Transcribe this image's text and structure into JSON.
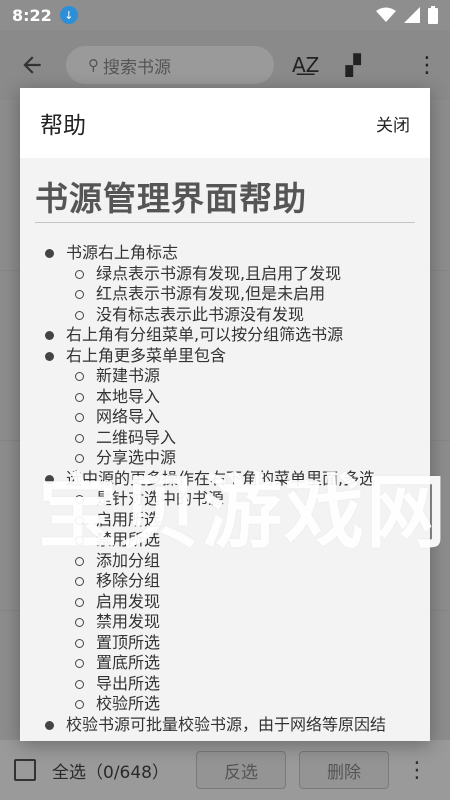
{
  "status_bar": {
    "time": "8:22",
    "icons": [
      "download-icon",
      "wifi-icon",
      "signal-icon",
      "battery-icon"
    ]
  },
  "toolbar": {
    "search_placeholder": "搜索书源",
    "icons": [
      "back-arrow-icon",
      "sort-az-icon",
      "group-icon",
      "more-vert-icon"
    ]
  },
  "bottom_bar": {
    "select_all_label": "全选（0/648）",
    "invert_label": "反选",
    "delete_label": "删除"
  },
  "dialog": {
    "title": "帮助",
    "close_label": "关闭",
    "heading": "书源管理界面帮助",
    "items": [
      {
        "text": "书源右上角标志",
        "children": [
          "绿点表示书源有发现,且启用了发现",
          "红点表示书源有发现,但是未启用",
          "没有标志表示此书源没有发现"
        ]
      },
      {
        "text": "右上角有分组菜单,可以按分组筛选书源",
        "children": []
      },
      {
        "text": "右上角更多菜单里包含",
        "children": [
          "新建书源",
          "本地导入",
          "网络导入",
          "二维码导入",
          "分享选中源"
        ]
      },
      {
        "text": "选中源的更多操作在右下角的菜单里面,多选",
        "children": [
          "是针对选中的书源",
          "启用所选",
          "禁用所选",
          "添加分组",
          "移除分组",
          "启用发现",
          "禁用发现",
          "置顶所选",
          "置底所选",
          "导出所选",
          "校验所选"
        ]
      },
      {
        "text": "校验书源可批量校验书源，由于网络等原因结",
        "children": []
      }
    ]
  },
  "watermark": "宝贝游戏网"
}
